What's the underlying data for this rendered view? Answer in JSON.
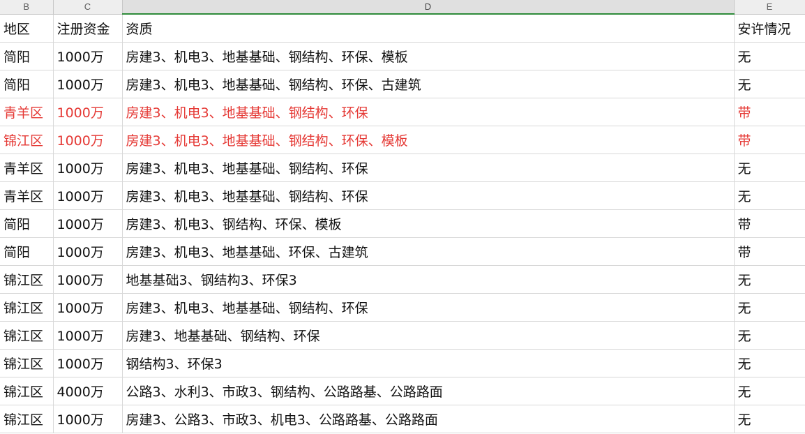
{
  "sheet": {
    "column_headers": [
      "B",
      "C",
      "D",
      "E"
    ],
    "header_row": [
      "地区",
      "注册资金",
      "资质",
      "安许情况"
    ],
    "rows": [
      [
        "简阳",
        "1000万",
        "房建3、机电3、地基基础、钢结构、环保、模板",
        "无"
      ],
      [
        "简阳",
        "1000万",
        "房建3、机电3、地基基础、钢结构、环保、古建筑",
        "无"
      ],
      [
        "青羊区",
        "1000万",
        "房建3、机电3、地基基础、钢结构、环保",
        "带"
      ],
      [
        "锦江区",
        "1000万",
        "房建3、机电3、地基基础、钢结构、环保、模板",
        "带"
      ],
      [
        "青羊区",
        "1000万",
        "房建3、机电3、地基基础、钢结构、环保",
        "无"
      ],
      [
        "青羊区",
        "1000万",
        "房建3、机电3、地基基础、钢结构、环保",
        "无"
      ],
      [
        "简阳",
        "1000万",
        "房建3、机电3、钢结构、环保、模板",
        "带"
      ],
      [
        "简阳",
        "1000万",
        "房建3、机电3、地基基础、环保、古建筑",
        "带"
      ],
      [
        "锦江区",
        "1000万",
        "地基基础3、钢结构3、环保3",
        "无"
      ],
      [
        "锦江区",
        "1000万",
        "房建3、机电3、地基基础、钢结构、环保",
        "无"
      ],
      [
        "锦江区",
        "1000万",
        "房建3、地基基础、钢结构、环保",
        "无"
      ],
      [
        "锦江区",
        "1000万",
        "钢结构3、环保3",
        "无"
      ],
      [
        "锦江区",
        "4000万",
        "公路3、水利3、市政3、钢结构、公路路基、公路路面",
        "无"
      ],
      [
        "锦江区",
        "1000万",
        "房建3、公路3、市政3、机电3、公路路基、公路路面",
        "无"
      ]
    ]
  },
  "colors": {
    "highlight_text": "#e53935",
    "active_column_border": "#2e8b3a"
  }
}
